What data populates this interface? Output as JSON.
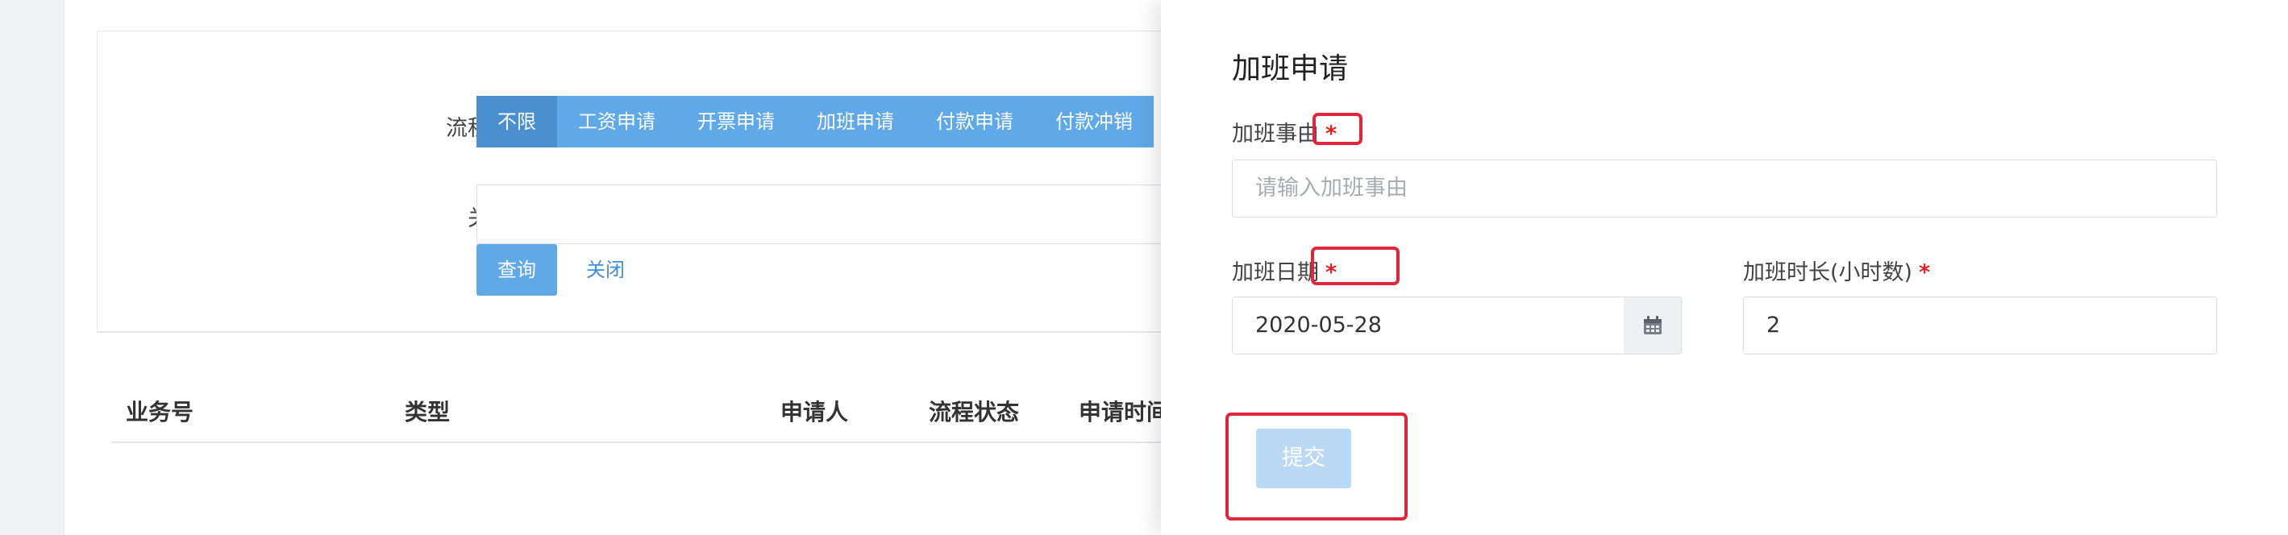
{
  "filter": {
    "flow_type_label": "流程类型",
    "flow_types": [
      "不限",
      "工资申请",
      "开票申请",
      "加班申请",
      "付款申请",
      "付款冲销"
    ],
    "keyword_label": "关键字",
    "keyword_value": "",
    "query_label": "查询",
    "close_label": "关闭"
  },
  "table": {
    "headers": [
      "业务号",
      "类型",
      "申请人",
      "流程状态",
      "申请时间"
    ]
  },
  "drawer": {
    "title": "加班申请",
    "reason_label": "加班事由",
    "reason_placeholder": "请输入加班事由",
    "date_label": "加班日期",
    "date_value": "2020-05-28",
    "hours_label": "加班时长(小时数)",
    "hours_value": "2",
    "required_mark": "*",
    "submit_label": "提交"
  },
  "colors": {
    "accent": "#5fa9e8",
    "accent_active": "#4a8fd0",
    "required": "#e02020",
    "highlight": "#e0263a",
    "submit_disabled": "#b9d9f4"
  }
}
